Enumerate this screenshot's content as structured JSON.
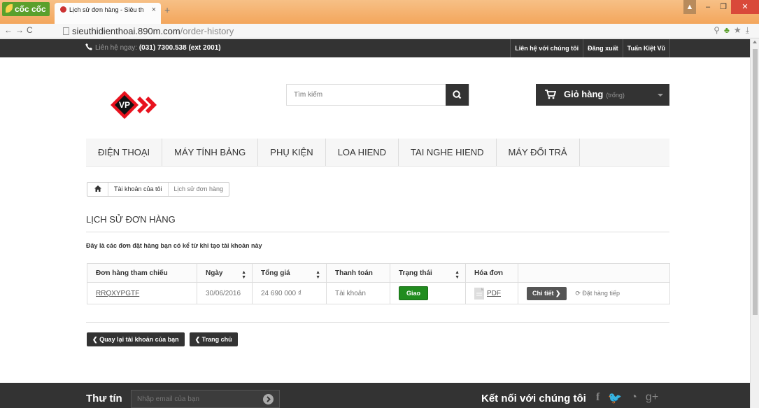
{
  "browser": {
    "brand": "cốc cốc",
    "tab_title": "Lịch sử đơn hàng - Siêu th",
    "tab_close": "×",
    "new_tab": "+",
    "url_host": "sieuthidienthoai.890m.com",
    "url_path": "/order-history"
  },
  "topbar": {
    "contact_label": "Liên hệ ngay:",
    "contact_phone": "(031) 7300.538 (ext 2001)",
    "links": [
      "Liên hệ với chúng tôi",
      "Đăng xuất",
      "Tuấn Kiệt Vũ"
    ]
  },
  "header": {
    "logo_text": "VP",
    "search_placeholder": "Tìm kiếm",
    "cart_label": "Giỏ hàng",
    "cart_status": "(trống)"
  },
  "menu": [
    "ĐIỆN THOẠI",
    "MÁY TÍNH BẢNG",
    "PHỤ KIỆN",
    "LOA HIEND",
    "TAI NGHE HIEND",
    "MÁY ĐỔI TRẢ"
  ],
  "breadcrumb": {
    "account": "Tài khoản của tôi",
    "current": "Lịch sử đơn hàng"
  },
  "page": {
    "title": "LỊCH SỬ ĐƠN HÀNG",
    "intro": "Đây là các đơn đặt hàng bạn có kể từ khi tạo tài khoản này"
  },
  "orders": {
    "headers": [
      "Đơn hàng tham chiếu",
      "Ngày",
      "Tổng giá",
      "Thanh toán",
      "Trạng thái",
      "Hóa đơn"
    ],
    "rows": [
      {
        "reference": "RRQXYPGTF",
        "date": "30/06/2016",
        "total": "24 690 000 ₫",
        "payment": "Tài khoản",
        "status": "Giao",
        "invoice": "PDF",
        "details": "Chi tiết",
        "reorder": "Đặt hàng tiếp"
      }
    ]
  },
  "buttons": {
    "back_account": "Quay lại tài khoản của bạn",
    "home": "Trang chủ"
  },
  "footer": {
    "newsletter_title": "Thư tín",
    "newsletter_placeholder": "Nhập email của bạn",
    "connect_title": "Kết nối với chúng tôi"
  },
  "colors": {
    "brand_red": "#e8121e",
    "status_green": "#218c1f",
    "dark_bar": "#333333",
    "browser_orange": "#f3a65c"
  }
}
